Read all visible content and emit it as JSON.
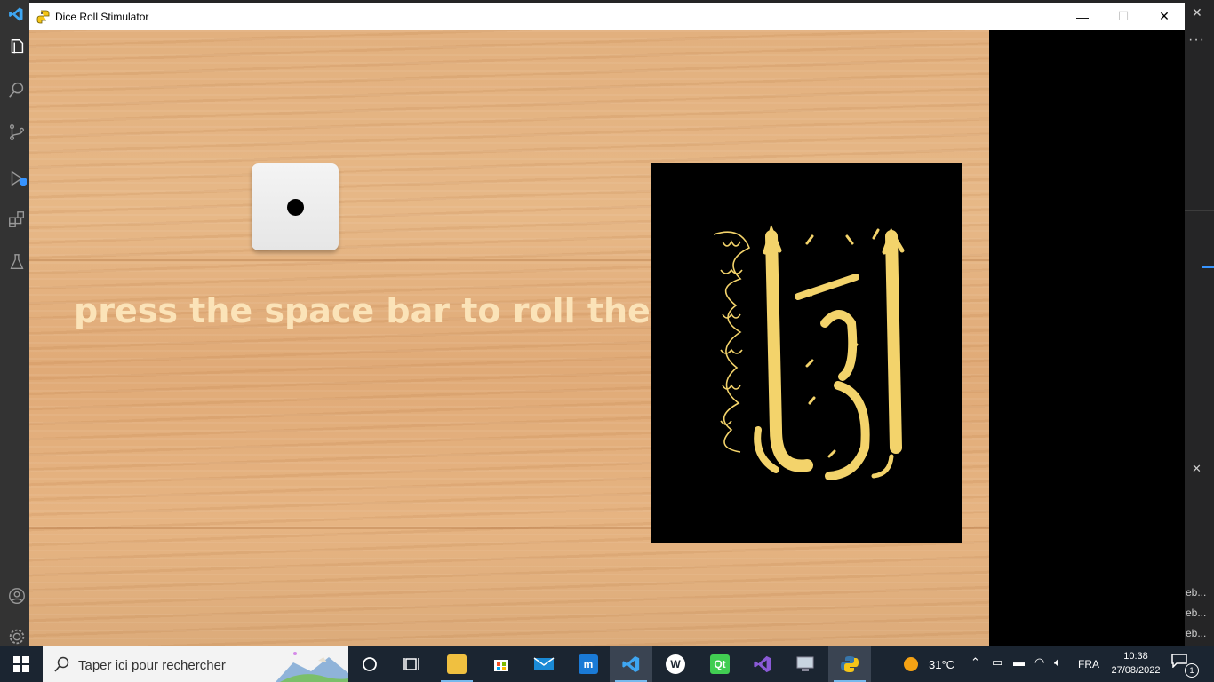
{
  "window": {
    "title": "Dice Roll Stimulator",
    "controls": {
      "minimize": "—",
      "maximize": "☐",
      "close": "✕"
    }
  },
  "game": {
    "instruction": "Press the Space Bar to roll the Dice",
    "die_face_value": 1,
    "image_alt_icon": "arabic-calligraphy-iqra"
  },
  "vscode": {
    "activity_icons": [
      "explorer-icon",
      "search-icon",
      "source-control-icon",
      "run-debug-icon",
      "extensions-icon",
      "testing-icon",
      "account-icon",
      "settings-gear-icon"
    ],
    "right_panel": {
      "more": "···",
      "close": "✕",
      "close2": "✕",
      "items": [
        "eb...",
        "eb...",
        "eb..."
      ]
    }
  },
  "taskbar": {
    "search_placeholder": "Taper ici pour rechercher",
    "apps": [
      "task-view-icon",
      "file-explorer-icon",
      "microsoft-store-icon",
      "mail-icon",
      "remote-desktop-icon",
      "vscode-icon",
      "browser-icon",
      "qt-creator-icon",
      "visual-studio-icon",
      "system-info-icon",
      "python-icon"
    ],
    "weather": "31°C",
    "language": "FRA",
    "time": "10:38",
    "date": "27/08/2022",
    "notification_count": "1"
  },
  "colors": {
    "title_bar": "#ffffff",
    "wood_base": "#e2b07e",
    "instruction_text": "#fbe3b8",
    "taskbar": "#1b2531",
    "vscode_accent": "#3794ff"
  }
}
